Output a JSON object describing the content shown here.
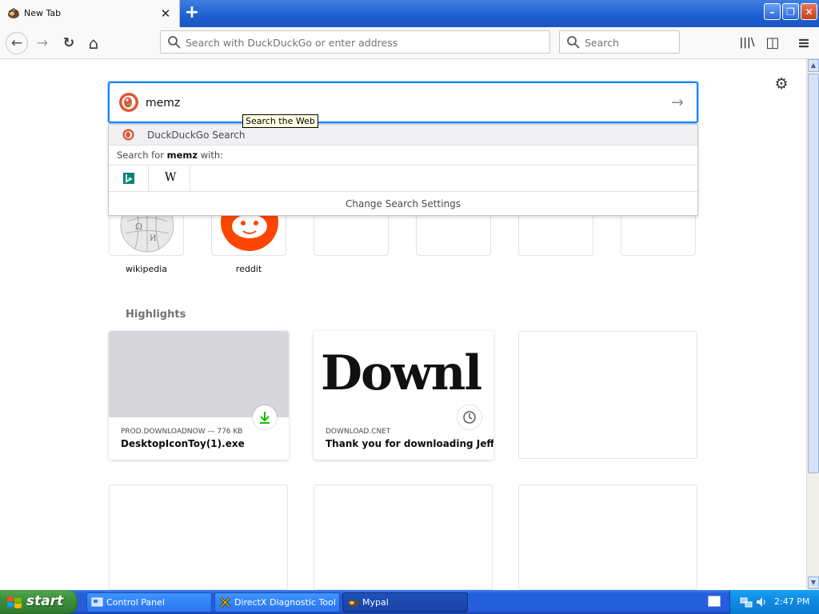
{
  "window": {
    "tab_title": "New Tab",
    "tab_close": "✕",
    "new_tab": "+",
    "minimize": "–",
    "restore": "❐",
    "close": "✕"
  },
  "toolbar": {
    "back": "←",
    "forward": "→",
    "reload": "↻",
    "home": "⌂",
    "url_placeholder": "Search with DuckDuckGo or enter address",
    "search_placeholder": "Search",
    "library": "|||\\",
    "sidebar": "◫",
    "menu": "≡"
  },
  "newtab": {
    "search_value": "memz",
    "go_arrow": "→",
    "tooltip": "Search the Web",
    "settings_icon": "⚙",
    "suggestions": {
      "engine_label": "DuckDuckGo Search",
      "search_for_prefix": "Search for ",
      "search_for_term": "memz",
      "search_for_suffix": " with:",
      "engines": [
        "bing-icon",
        "wikipedia-icon"
      ],
      "change_settings": "Change Search Settings"
    },
    "top_sites": [
      {
        "label": "wikipedia",
        "icon": "wikipedia-globe-icon"
      },
      {
        "label": "reddit",
        "icon": "reddit-icon"
      },
      {
        "label": ""
      },
      {
        "label": ""
      },
      {
        "label": ""
      },
      {
        "label": ""
      }
    ],
    "highlights_title": "Highlights",
    "highlights": [
      {
        "source": "PROD.DOWNLOADNOW — 776 KB",
        "title": "DesktopIconToy(1).exe",
        "badge": "download-icon"
      },
      {
        "source": "DOWNLOAD.CNET",
        "title": "Thank you for downloading Jeff'...",
        "image_text": "Downl",
        "badge": "clock-icon"
      }
    ]
  },
  "taskbar": {
    "start": "start",
    "tasks": [
      {
        "label": "Control Panel",
        "icon": "control-panel-icon"
      },
      {
        "label": "DirectX Diagnostic Tool",
        "icon": "directx-icon"
      },
      {
        "label": "Mypal",
        "icon": "mypal-icon"
      }
    ],
    "clock": "2:47 PM"
  },
  "colors": {
    "focus_ring": "#0a84ff",
    "taskbar_blue": "#245edb",
    "start_green": "#3c8f3c",
    "download_green": "#12bc00"
  }
}
